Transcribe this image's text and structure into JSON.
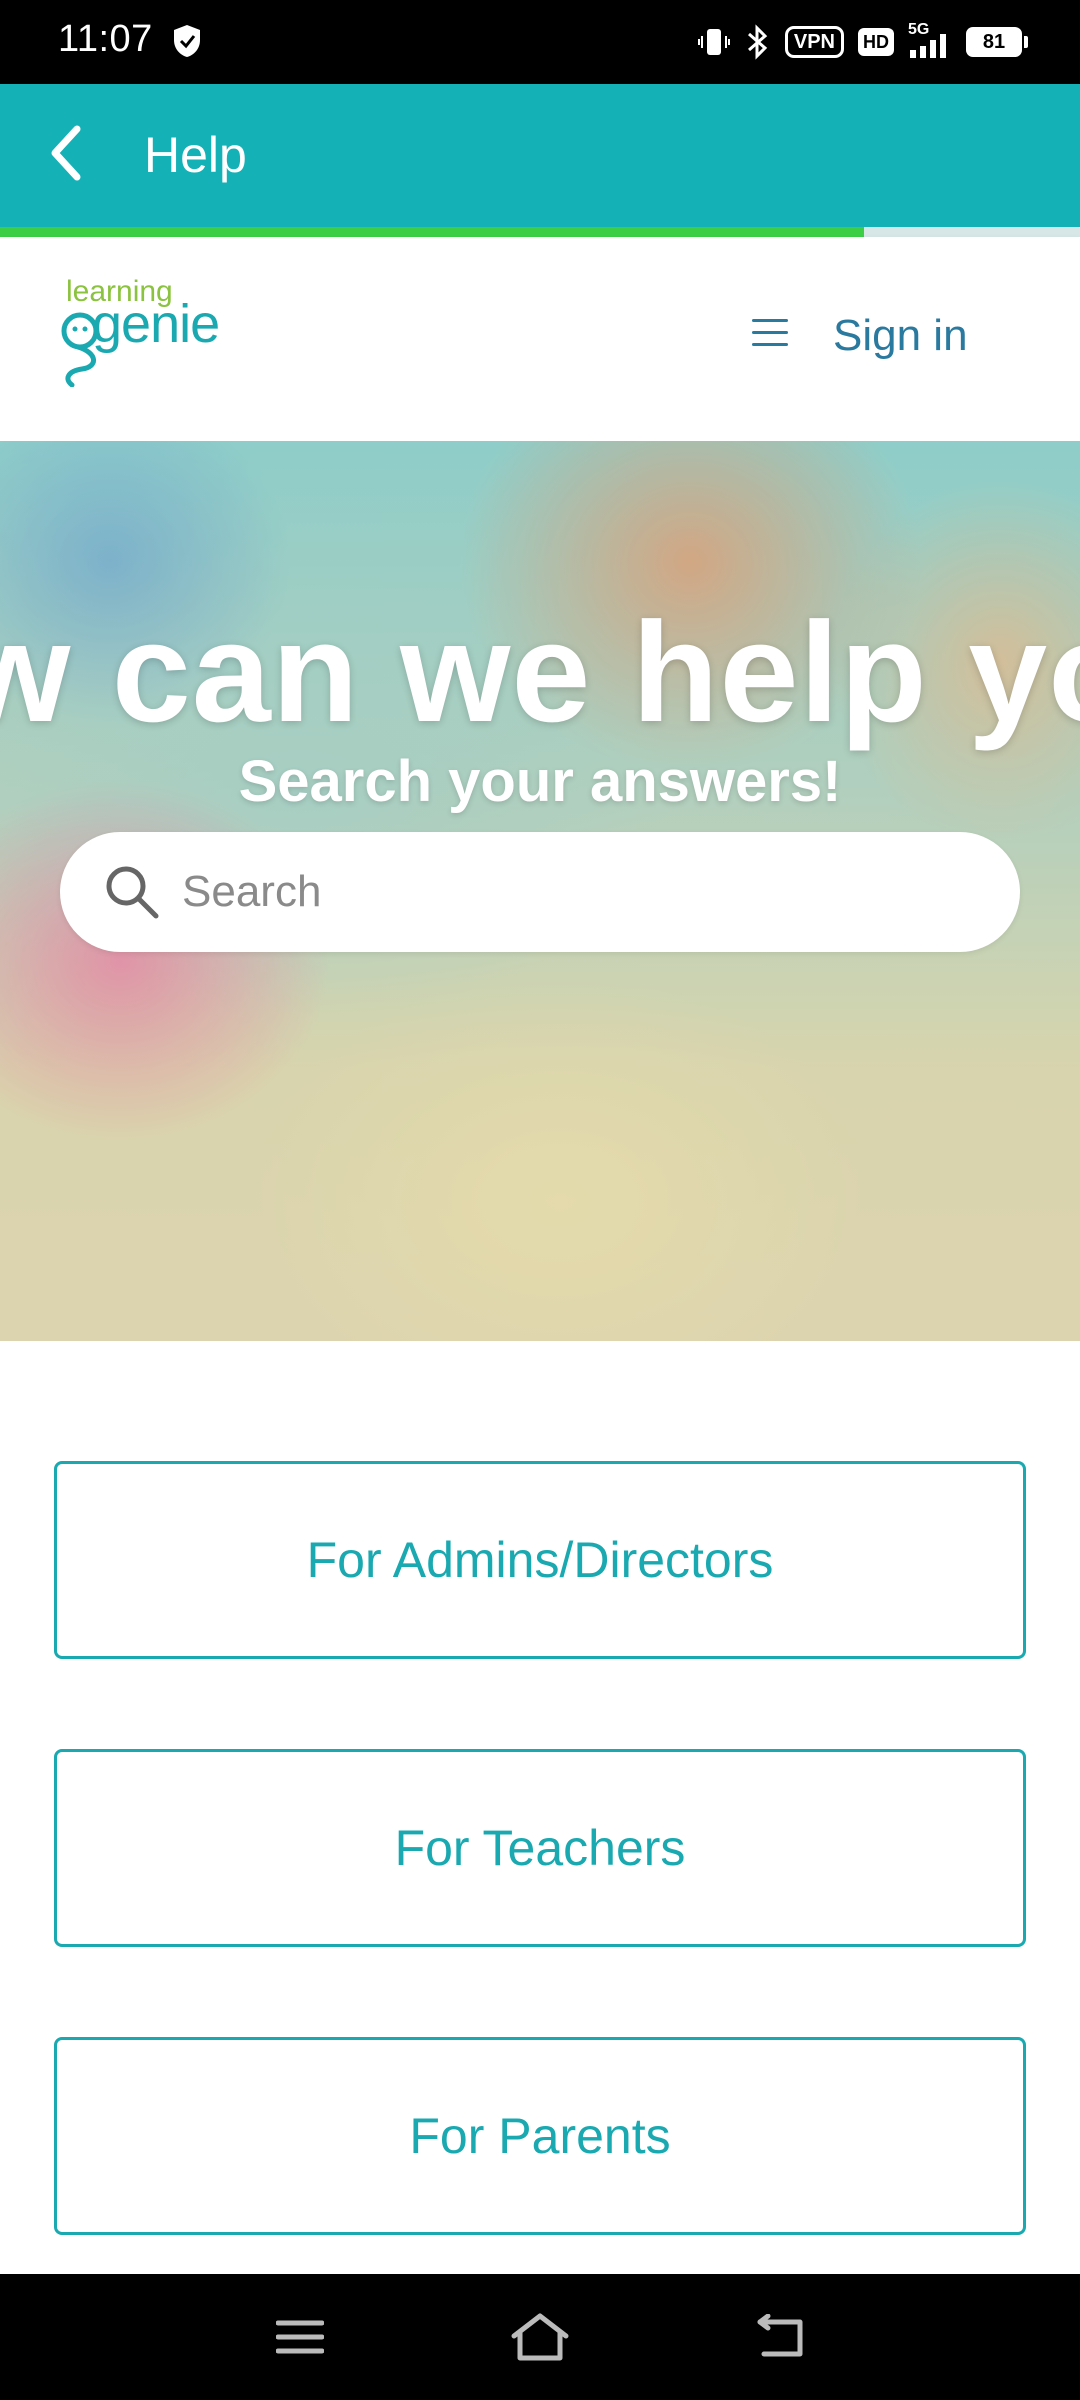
{
  "status_bar": {
    "time": "11:07",
    "vpn": "VPN",
    "hd": "HD",
    "network": "5G",
    "battery": "81",
    "icons": [
      "shield-icon",
      "vibrate-icon",
      "bluetooth-icon",
      "vpn-icon",
      "hd-icon",
      "signal-5g-icon",
      "battery-icon"
    ]
  },
  "app_bar": {
    "title": "Help",
    "back_icon": "chevron-left-icon",
    "page_load_progress": 0.8,
    "background_color": "#14b1b6",
    "progress_color": "#3ccf46"
  },
  "site_nav": {
    "logo_top": "learning",
    "logo_bottom": "genie",
    "menu_icon": "hamburger-icon",
    "sign_in": "Sign in"
  },
  "hero": {
    "heading": "How can we help you?",
    "subheading": "Search your answers!",
    "search_placeholder": "Search",
    "search_icon": "search-icon"
  },
  "categories": [
    {
      "label": "For Admins/Directors"
    },
    {
      "label": "For Teachers"
    },
    {
      "label": "For Parents"
    }
  ],
  "accent_color": "#1aa9b0",
  "nav_bar": {
    "icons": [
      "menu-icon",
      "home-icon",
      "back-icon"
    ]
  }
}
